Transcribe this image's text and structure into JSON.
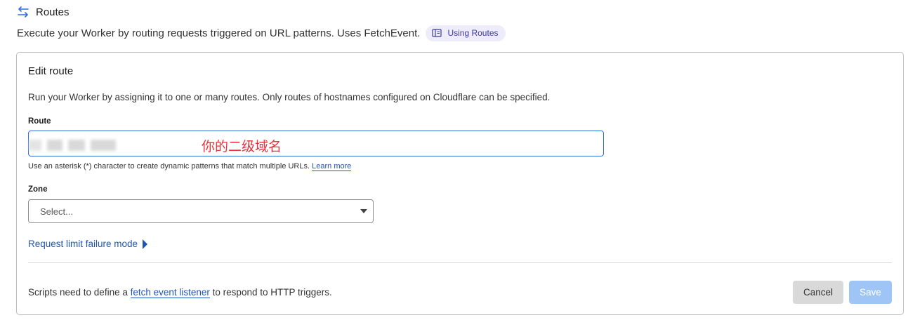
{
  "header": {
    "title": "Routes",
    "icon": "swap-arrows-icon",
    "description": "Execute your Worker by routing requests triggered on URL patterns. Uses FetchEvent.",
    "docs_pill": {
      "label": "Using Routes",
      "icon": "book-icon"
    }
  },
  "card": {
    "title": "Edit route",
    "description": "Run your Worker by assigning it to one or many routes. Only routes of hostnames configured on Cloudflare can be specified.",
    "route": {
      "label": "Route",
      "annotation": "你的二级域名",
      "helper_text": "Use an asterisk (*) character to create dynamic patterns that match multiple URLs.",
      "helper_link": "Learn more"
    },
    "zone": {
      "label": "Zone",
      "placeholder": "Select..."
    },
    "limit_link": "Request limit failure mode",
    "footer": {
      "text_before": "Scripts need to define a ",
      "link": "fetch event listener",
      "text_after": " to respond to HTTP triggers."
    },
    "buttons": {
      "cancel": "Cancel",
      "save": "Save"
    }
  },
  "colors": {
    "accent": "#1f54b7",
    "input_focus": "#2f6fe0",
    "annotation": "#e8323c",
    "save_disabled": "#9ec5f5",
    "cancel_bg": "#d9d9d9",
    "pill_bg": "#eeebfb"
  }
}
